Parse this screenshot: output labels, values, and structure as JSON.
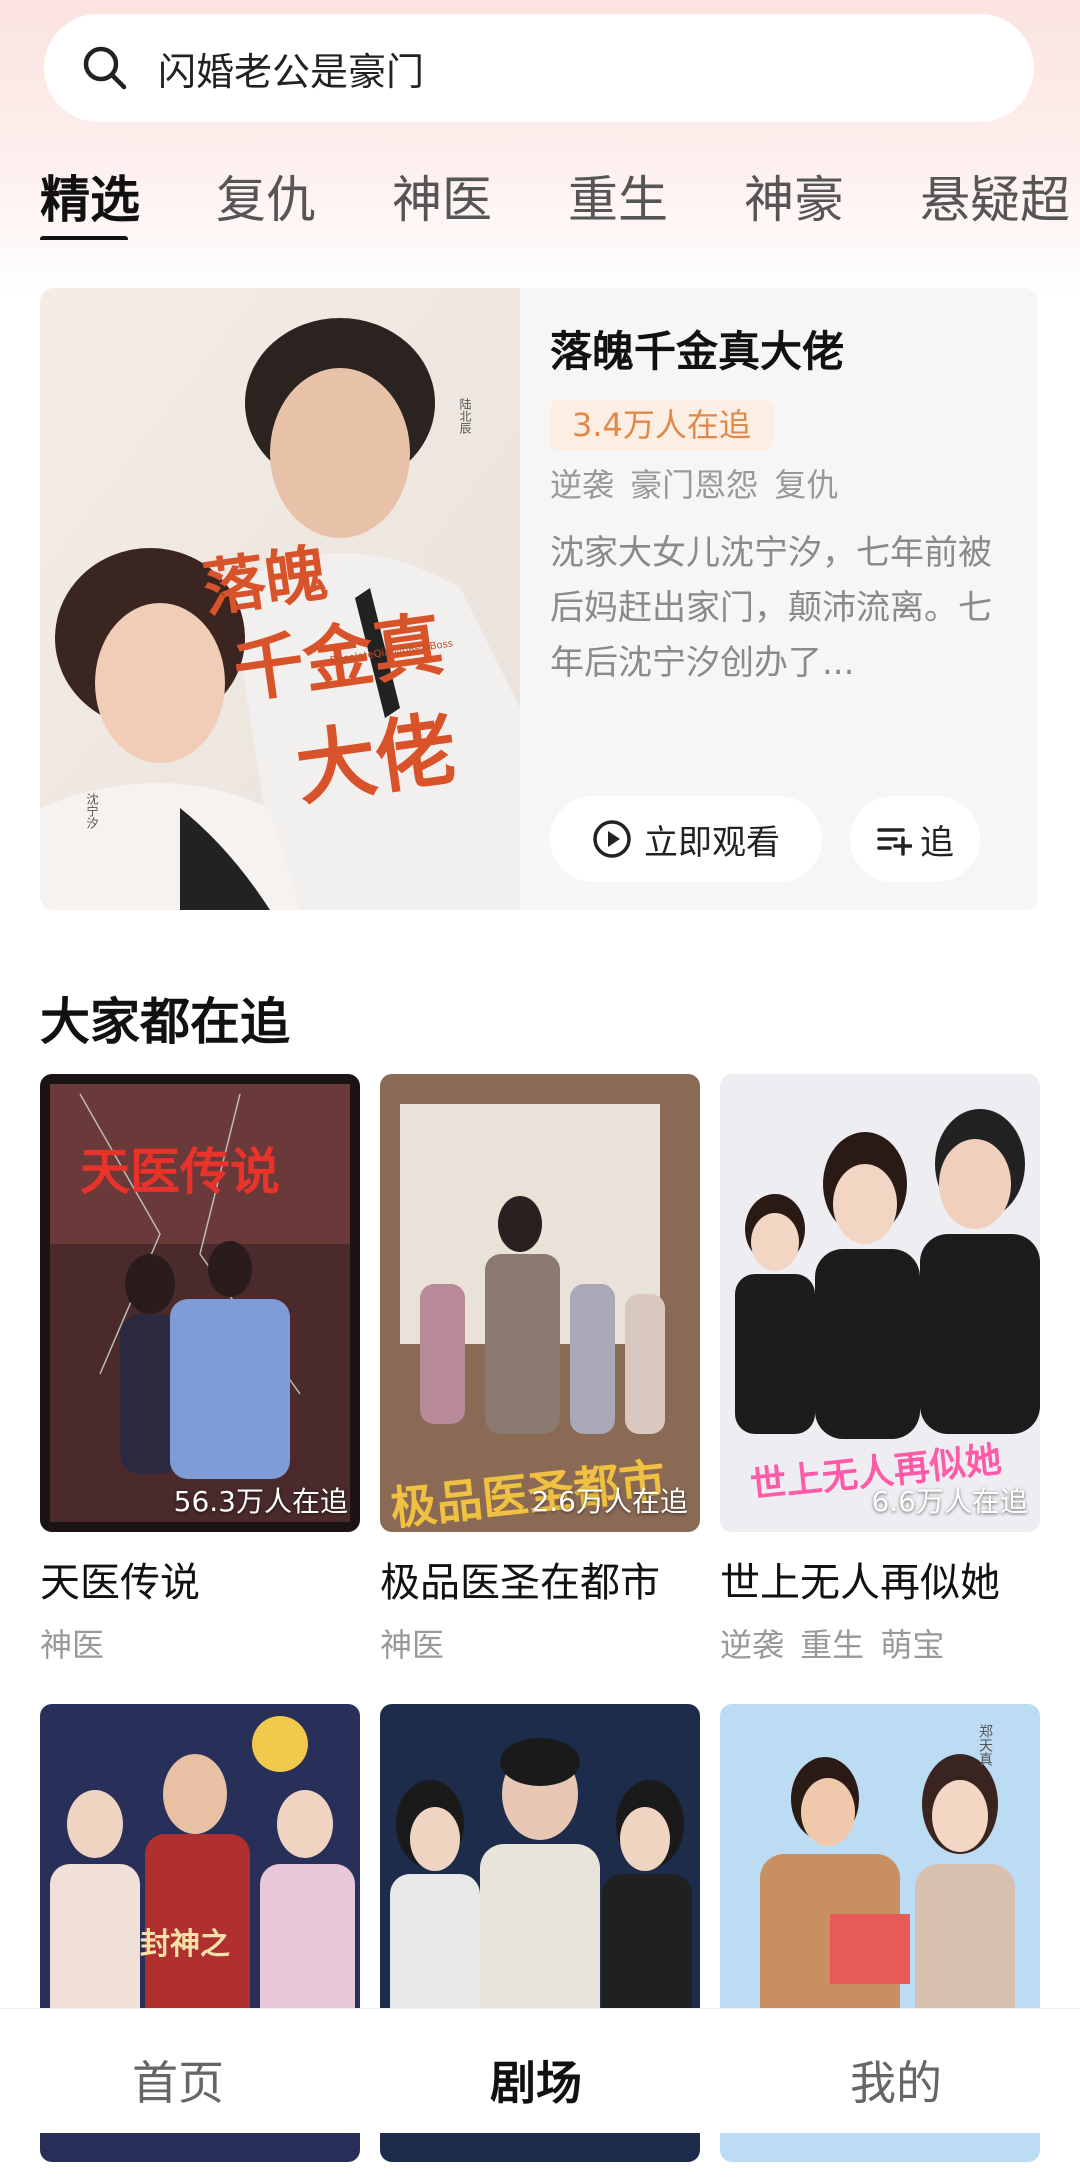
{
  "search": {
    "placeholder": "闪婚老公是豪门",
    "icon": "search-icon"
  },
  "tabs": [
    "精选",
    "复仇",
    "神医",
    "重生",
    "神豪",
    "悬疑超"
  ],
  "active_tab": "精选",
  "featured": {
    "title": "落魄千金真大佬",
    "followers": "3.4万人在追",
    "tags": "逆袭 豪门恩怨 复仇",
    "description": "沈家大女儿沈宁汐，七年前被后妈赶出家门，颠沛流离。七年后沈宁汐创办了...",
    "watch_label": "立即观看",
    "follow_label": "追",
    "poster_title": "落魄千金真大佬",
    "poster_caption_right": "陆北辰",
    "poster_caption_left": "沈宁汐",
    "poster_subtitle": "DesolateQianjinRealBoss"
  },
  "section_title": "大家都在追",
  "cards": [
    {
      "title": "天医传说",
      "tags": "神医",
      "count": "56.3万人在追",
      "poster_text": "天医传说"
    },
    {
      "title": "极品医圣在都市",
      "tags": "神医",
      "count": "2.6万人在追",
      "poster_text": "极品医圣都市"
    },
    {
      "title": "世上无人再似她",
      "tags": "逆袭 重生 萌宝",
      "count": "6.6万人在追",
      "poster_text": "世上无人再似她"
    },
    {
      "title": "",
      "tags": "",
      "count": "",
      "poster_text": "封神之"
    },
    {
      "title": "",
      "tags": "",
      "count": "",
      "poster_text": ""
    },
    {
      "title": "",
      "tags": "",
      "count": "",
      "poster_text": "郑天真"
    }
  ],
  "bottom_nav": [
    "首页",
    "剧场",
    "我的"
  ],
  "colors": {
    "accent_orange": "#e0884a",
    "badge_bg": "#fdeee4",
    "top_bg": "#fbe3e0"
  }
}
